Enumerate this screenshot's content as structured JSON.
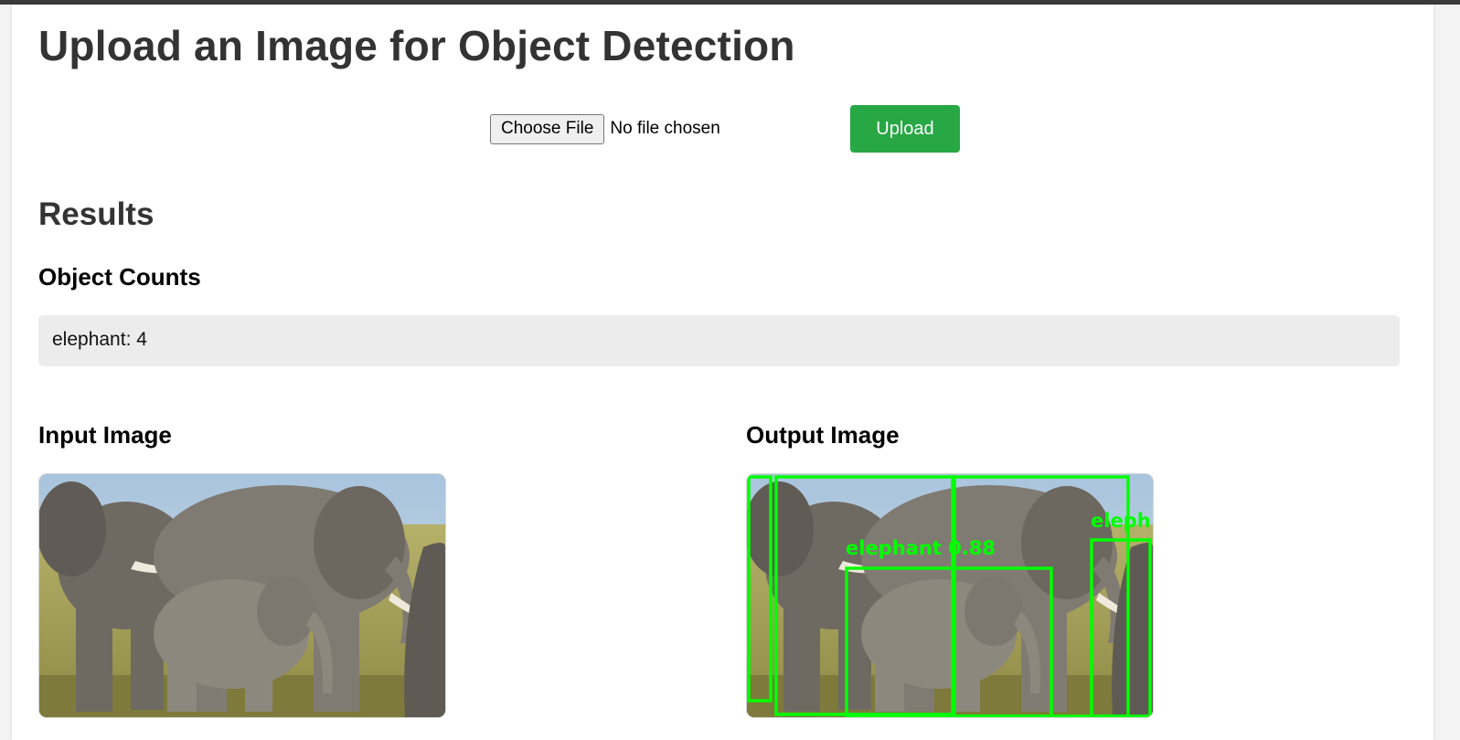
{
  "page": {
    "title": "Upload an Image for Object Detection"
  },
  "upload_form": {
    "choose_file_label": "Choose File",
    "file_status": "No file chosen",
    "upload_label": "Upload",
    "upload_color": "#28a745"
  },
  "results": {
    "heading": "Results",
    "counts_heading": "Object Counts",
    "counts": [
      {
        "text": "elephant: 4"
      }
    ]
  },
  "images": {
    "input": {
      "heading": "Input Image",
      "content": "photo of a herd of elephants on grassland"
    },
    "output": {
      "heading": "Output Image",
      "box_color": "#00ff00",
      "detections": [
        {
          "label": "elephant 0.88"
        },
        {
          "label": "eleph"
        }
      ]
    }
  }
}
